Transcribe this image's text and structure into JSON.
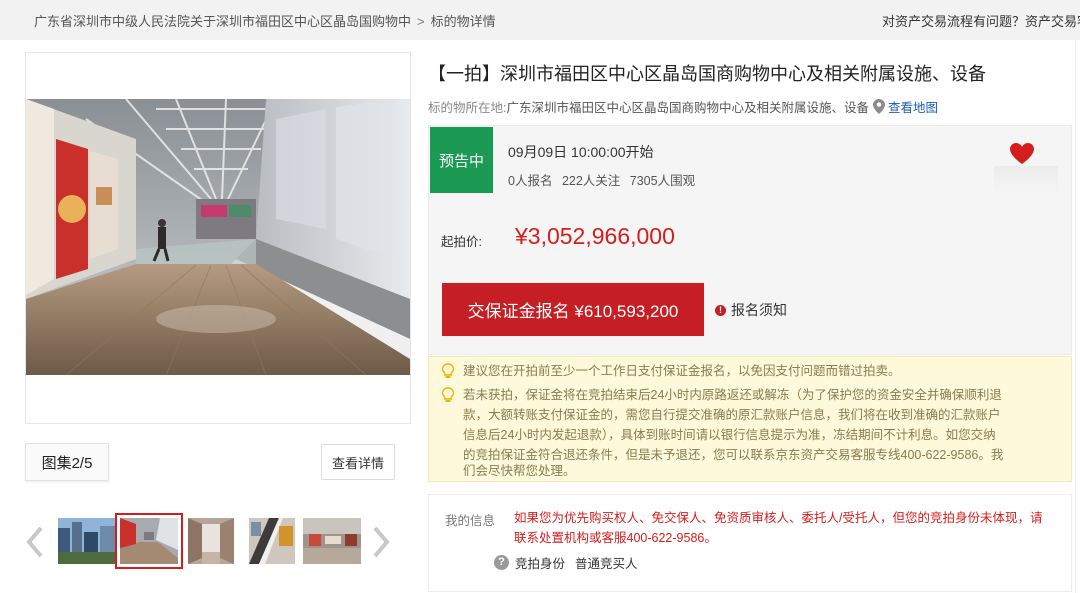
{
  "breadcrumb": {
    "court": "广东省深圳市中级人民法院关于深圳市福田区中心区晶岛国购物中",
    "separator": ">",
    "current": "标的物详情"
  },
  "help_text": "对资产交易流程有问题？资产交易客",
  "gallery": {
    "album_label": "图集2/5",
    "detail_button": "查看详情",
    "thumbnail_count": 5,
    "active_thumbnail": 2
  },
  "item": {
    "title": "【一拍】深圳市福田区中心区晶岛国商购物中心及相关附属设施、设备",
    "location_label": "标的物所在地:",
    "location": "广东深圳市福田区中心区晶岛国商购物中心及相关附属设施、设备",
    "map_link": "查看地图"
  },
  "auction": {
    "status": "预告中",
    "start_time": "09月09日 10:00:00开始",
    "registered": "0人报名",
    "followers": "222人关注",
    "viewers": "7305人围观",
    "price_label": "起拍价:",
    "start_price": "¥3,052,966,000",
    "deposit_button": "交保证金报名 ¥610,593,200",
    "notice_link": "报名须知",
    "notice_icon": "!"
  },
  "tips": [
    "建议您在开拍前至少一个工作日支付保证金报名，以免因支付问题而错过拍卖。",
    "若未获拍，保证金将在竞拍结束后24小时内原路返还或解冻（为了保护您的资金安全并确保顺利退",
    "款，大额转账支付保证金的，需您自行提交准确的原汇款账户信息，我们将在收到准确的汇款账户",
    "信息后24小时内发起退款），具体到账时间请以银行信息提示为准，冻结期间不计利息。如您交纳",
    "的竞拍保证金符合退还条件，但是未予退还，您可以联系京东资产交易客服专线400-622-9586。我",
    "们会尽快帮您处理。"
  ],
  "my_info": {
    "label": "我的信息",
    "line1": "如果您为优先购买权人、免交保人、免资质审核人、委托人/受托人，但您的竞拍身份未体现，请",
    "line2": "联系处置机构或客服400-622-9586。",
    "identity_icon": "?",
    "identity_label": "竞拍身份",
    "identity_value": "普通竞买人"
  },
  "colors": {
    "accent_red": "#c51f25",
    "price_red": "#d61d1d",
    "status_green": "#1a9a52",
    "link_blue": "#1a5db8",
    "tip_bg": "#fdf9da"
  },
  "icons": [
    "map-pin-icon",
    "heart-icon",
    "lightbulb-icon",
    "chevron-left-icon",
    "chevron-right-icon",
    "question-icon",
    "alert-icon"
  ]
}
